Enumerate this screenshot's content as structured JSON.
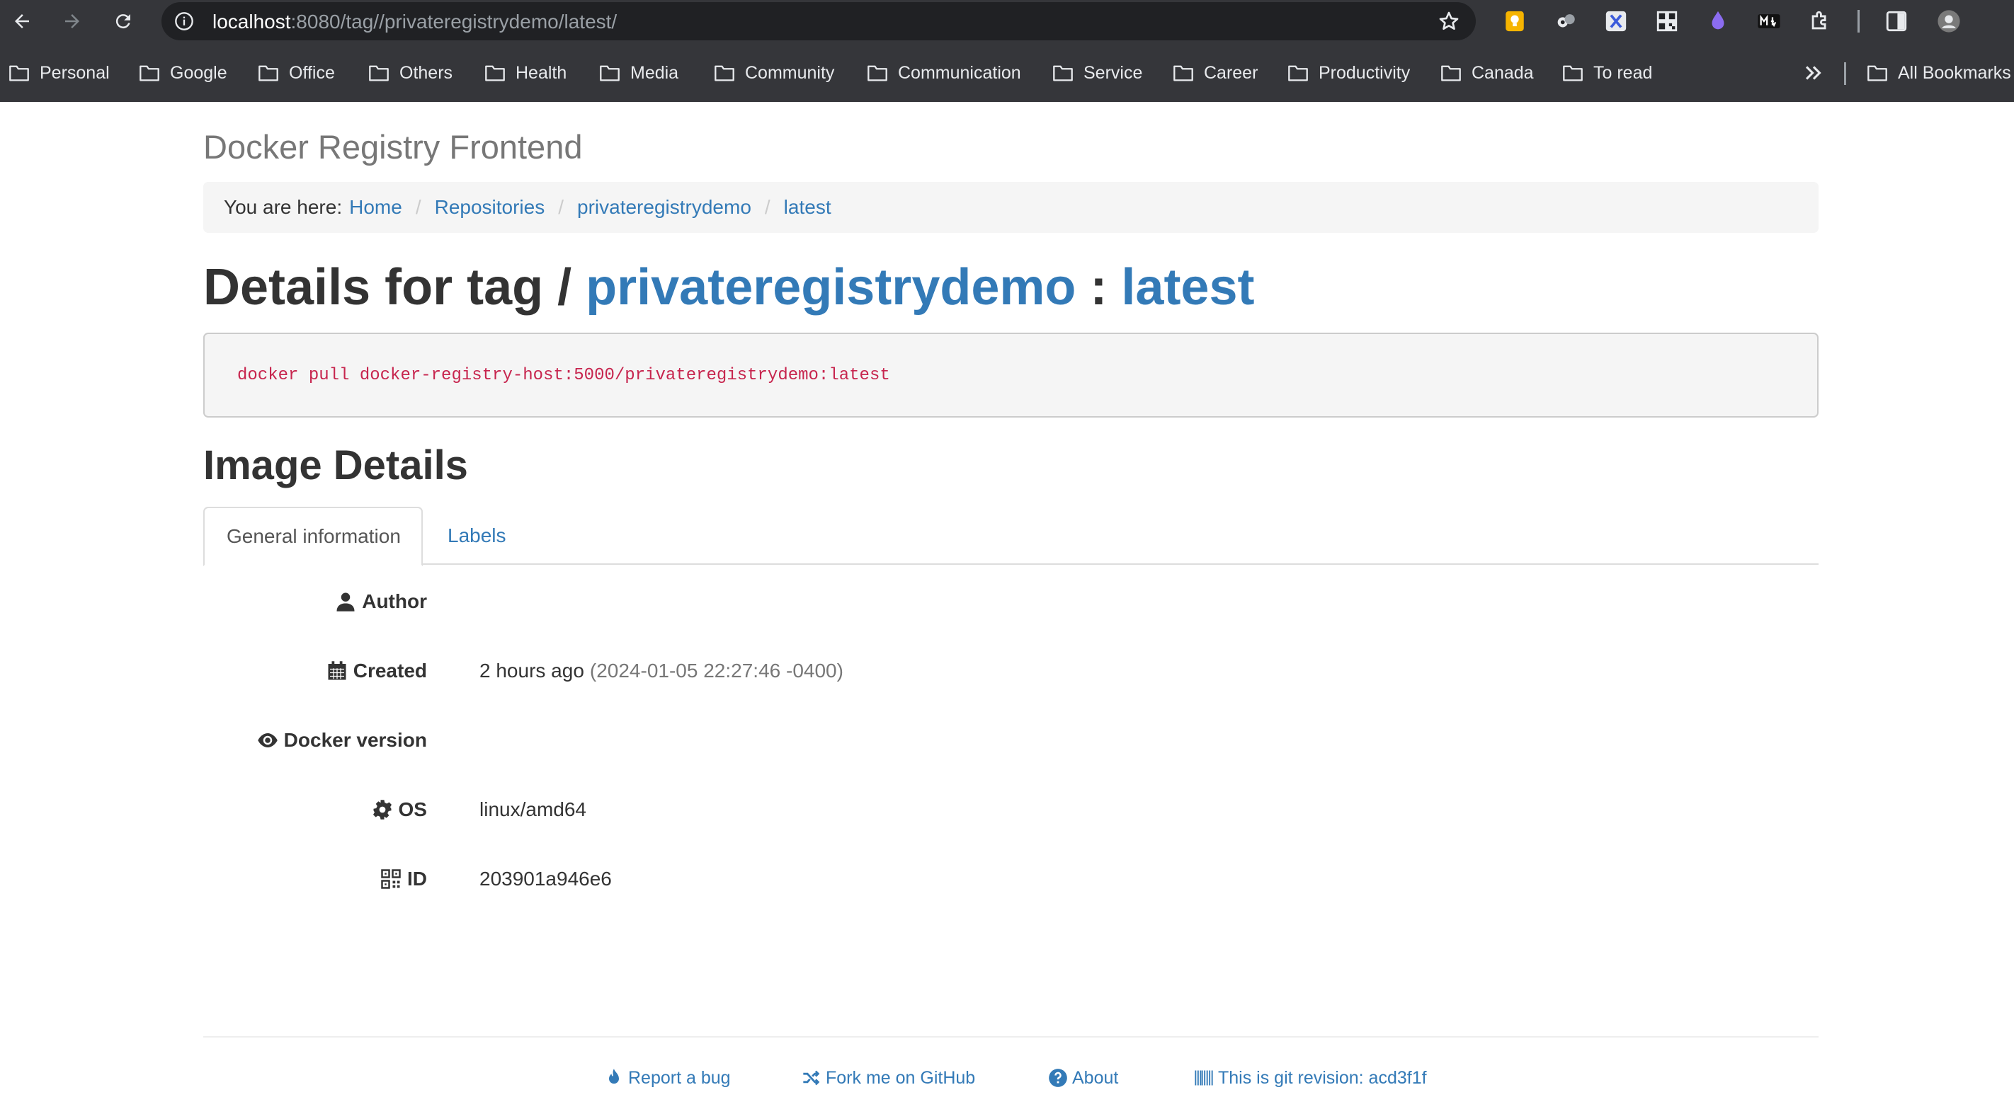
{
  "browser": {
    "url_host": "localhost",
    "url_rest": ":8080/tag//privateregistrydemo/latest/",
    "bookmarks": [
      "Personal",
      "Google",
      "Office",
      "Others",
      "Health",
      "Media",
      "Community",
      "Communication",
      "Service",
      "Career",
      "Productivity",
      "Canada",
      "To read"
    ],
    "all_bookmarks_label": "All Bookmarks",
    "extension_icons": [
      "keep-icon",
      "spy-icon",
      "x-icon",
      "qr-code-icon",
      "drop-icon",
      "markdown-icon",
      "puzzle-icon",
      "side-panel-icon",
      "profile-avatar"
    ]
  },
  "app": {
    "brand": "Docker Registry Frontend",
    "breadcrumb": {
      "prefix": "You are here:",
      "items": [
        "Home",
        "Repositories",
        "privateregistrydemo",
        "latest"
      ]
    },
    "heading": {
      "prefix": "Details for tag /",
      "repo": "privateregistrydemo",
      "colon": ":",
      "tag": "latest"
    },
    "pull_command": "docker pull docker-registry-host:5000/privateregistrydemo:latest",
    "section_title": "Image Details",
    "tabs": [
      "General information",
      "Labels"
    ],
    "details": [
      {
        "label": "Author",
        "icon": "user-icon",
        "value": "",
        "extra": ""
      },
      {
        "label": "Created",
        "icon": "calendar-icon",
        "value": "2 hours ago",
        "extra": "(2024-01-05 22:27:46 -0400)"
      },
      {
        "label": "Docker version",
        "icon": "eye-icon",
        "value": "",
        "extra": ""
      },
      {
        "label": "OS",
        "icon": "cog-icon",
        "value": "linux/amd64",
        "extra": ""
      },
      {
        "label": "ID",
        "icon": "qr-code-icon",
        "value": "203901a946e6",
        "extra": ""
      }
    ],
    "footer": {
      "report_bug": "Report a bug",
      "fork": "Fork me on GitHub",
      "about": "About",
      "revision": "This is git revision: acd3f1f"
    }
  },
  "colors": {
    "chrome_bg": "#35363a",
    "omnibox_bg": "#202124",
    "link": "#337ab7",
    "code": "#c7254e",
    "muted": "#777777"
  }
}
